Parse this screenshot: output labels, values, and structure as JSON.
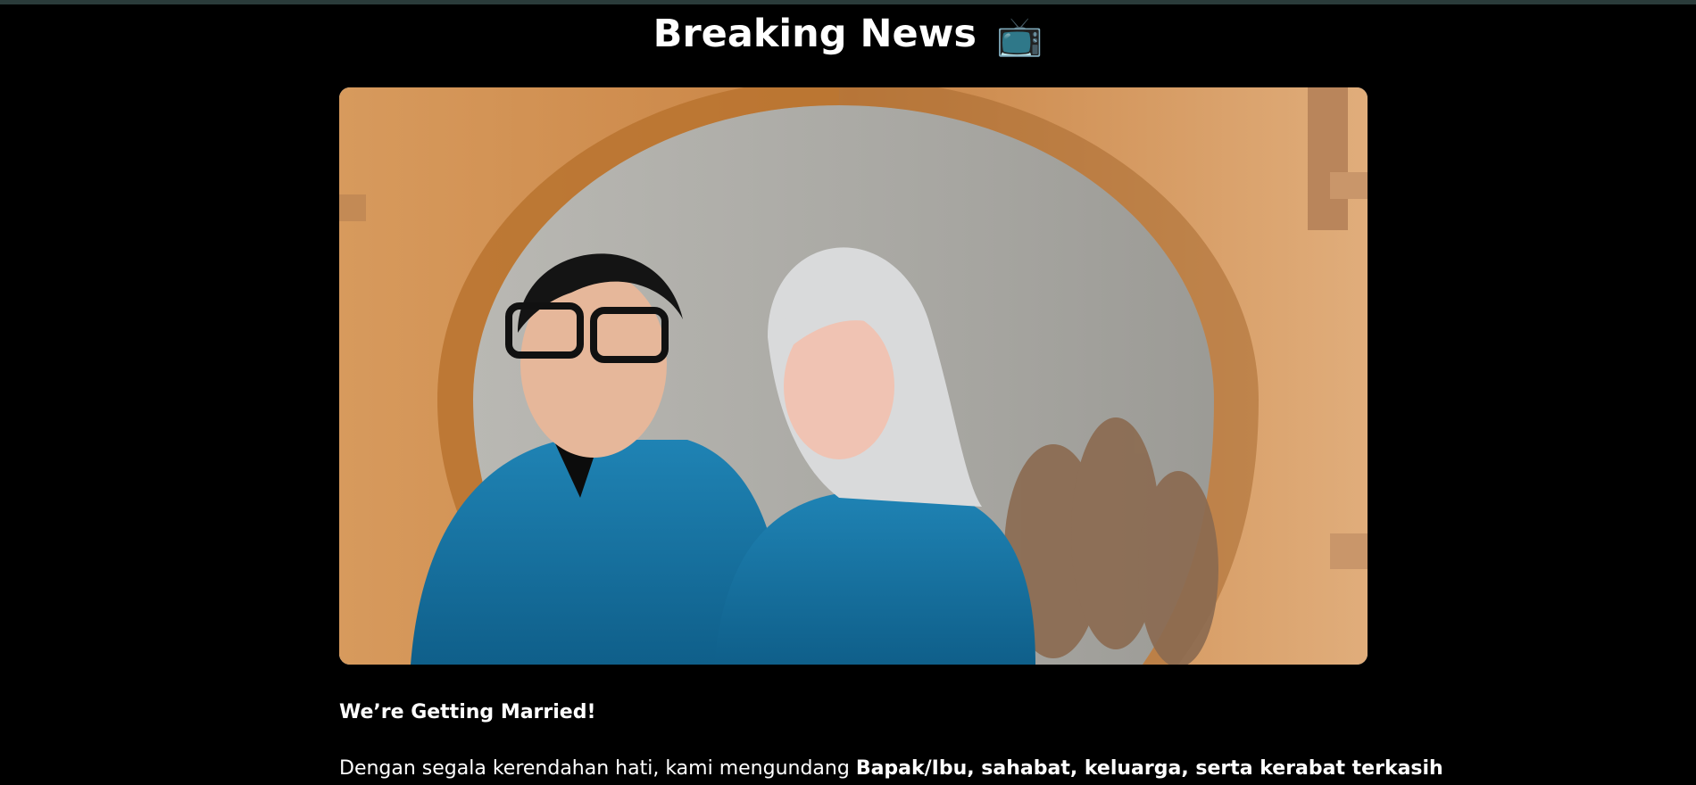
{
  "header": {
    "title": "Breaking News",
    "title_icon": "tv-icon",
    "title_icon_glyph": "📺"
  },
  "hero_image": {
    "icon": "couple-photo"
  },
  "article": {
    "subheading": "We’re Getting Married!",
    "paragraph_text": "Dengan segala kerendahan hati, kami mengundang ",
    "paragraph_bold": "Bapak/Ibu, sahabat, keluarga, serta kerabat terkasih"
  },
  "colors": {
    "background": "#000000",
    "text": "#ffffff",
    "top_strip": "#2a3b3a"
  }
}
